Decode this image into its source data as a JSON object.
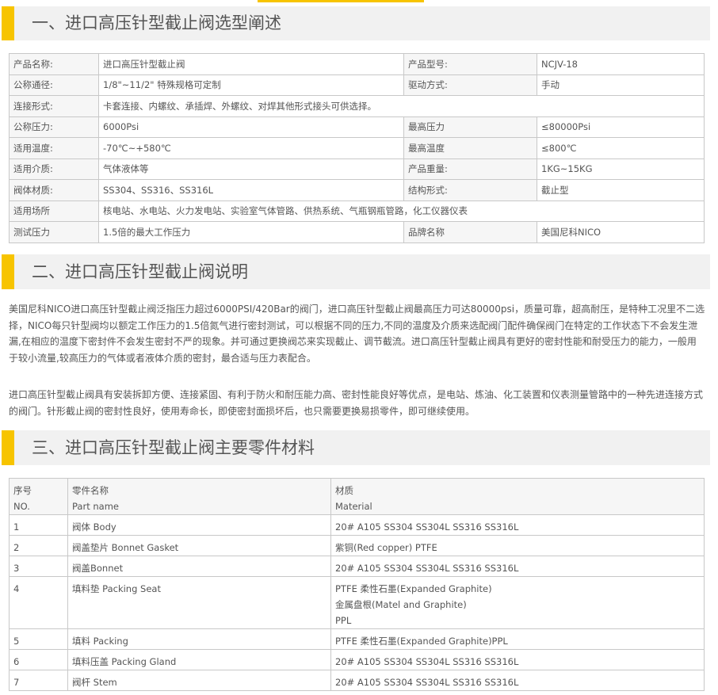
{
  "sections": [
    {
      "title": "一、进口高压针型截止阀选型阐述"
    },
    {
      "title": "二、进口高压针型截止阀说明"
    },
    {
      "title": "三、进口高压针型截止阀主要零件材料"
    }
  ],
  "spec_rows": [
    {
      "cells": [
        "产品名称:",
        "进口高压针型截止阀",
        "产品型号:",
        "NCJV-18"
      ]
    },
    {
      "cells": [
        "公称通径:",
        "1/8\"~11/2\" 特殊规格可定制",
        "驱动方式:",
        "手动"
      ]
    },
    {
      "cells": [
        "连接形式:",
        "卡套连接、内螺纹、承插焊、外螺纹、对焊其他形式接头可供选择。"
      ]
    },
    {
      "cells": [
        "公称压力:",
        "6000Psi",
        "最高压力",
        "≤80000Psi"
      ]
    },
    {
      "cells": [
        "适用温度:",
        "-70℃~+580℃",
        "最高温度",
        "≤800℃"
      ]
    },
    {
      "cells": [
        "适用介质:",
        "气体液体等",
        "产品重量:",
        "1KG~15KG"
      ]
    },
    {
      "cells": [
        "阀体材质:",
        "SS304、SS316、SS316L",
        "结构形式:",
        "截止型"
      ]
    },
    {
      "cells": [
        "适用场所",
        "核电站、水电站、火力发电站、实验室气体管路、供热系统、气瓶钢瓶管路，化工仪器仪表"
      ]
    },
    {
      "cells": [
        "测试压力",
        "1.5倍的最大工作压力",
        "品牌名称",
        "美国尼科NICO"
      ]
    }
  ],
  "description": {
    "para1": [
      "美国尼科NICO进口高压针型截止阀泛指压力超过6000PSI/420Bar的阀门，进口高压针型截止阀最高压力可达80000psi，质量可靠，超高耐压，是特种工况里不二选",
      "择，NICO每只针型阀均以额定工作压力的1.5倍氮气进行密封测试，可以根据不同的压力,不同的温度及介质来选配阀门配件确保阀门在特定的工作状态下不会发生泄",
      "漏,在相应的温度下密封件不会发生密封不严的现象。并可通过更换阀芯来实现截止、调节截流。进口高压针型截止阀具有更好的密封性能和耐受压力的能力，一般用",
      "于较小流量,较高压力的气体或者液体介质的密封，最合适与压力表配合。"
    ],
    "para2": [
      "进口高压针型截止阀具有安装拆卸方便、连接紧固、有利于防火和耐压能力高、密封性能良好等优点，是电站、炼油、化工装置和仪表测量管路中的一种先进连接方式",
      "的阀门。针形截止阀的密封性良好，使用寿命长，即使密封面损坏后，也只需要更换易损零件，即可继续使用。"
    ]
  },
  "parts_header": {
    "no": [
      "序号",
      "NO."
    ],
    "name": [
      "零件名称",
      "Part name"
    ],
    "material": [
      "材质",
      "Material"
    ]
  },
  "parts_rows": [
    {
      "no": "1",
      "name": "阀体 Body",
      "material": [
        "20# A105 SS304 SS304L SS316 SS316L"
      ]
    },
    {
      "no": "2",
      "name": "阀盖垫片 Bonnet Gasket",
      "material": [
        "紫铜(Red copper) PTFE"
      ]
    },
    {
      "no": "3",
      "name": "阀盖Bonnet",
      "material": [
        "20# A105 SS304 SS304L SS316 SS316L"
      ]
    },
    {
      "no": "4",
      "name": "填料垫 Packing Seat",
      "material": [
        "PTFE 柔性石墨(Expanded Graphite)",
        "金属盘根(Matel and Graphite)",
        "PPL"
      ]
    },
    {
      "no": "5",
      "name": "填料 Packing",
      "material": [
        "PTFE 柔性石墨(Expanded Graphite)PPL"
      ]
    },
    {
      "no": "6",
      "name": "填料压盖 Packing Gland",
      "material": [
        "20# A105 SS304 SS304L SS316 SS316L"
      ]
    },
    {
      "no": "7",
      "name": "阀杆 Stem",
      "material": [
        "20# A105 SS304 SS304L SS316 SS316L"
      ]
    }
  ]
}
